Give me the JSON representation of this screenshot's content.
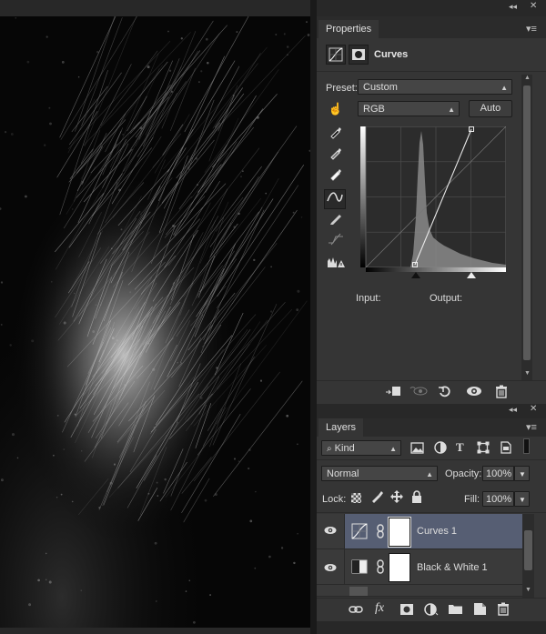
{
  "properties_panel": {
    "tab_label": "Properties",
    "panel_title": "Curves",
    "preset_label": "Preset:",
    "preset_value": "Custom",
    "channel_value": "RGB",
    "auto_button": "Auto",
    "input_label": "Input:",
    "output_label": "Output:",
    "tools": [
      "hand-adjust-icon",
      "sample-black-eyedropper-icon",
      "sample-gray-eyedropper-icon",
      "sample-white-eyedropper-icon",
      "curve-points-icon",
      "pencil-draw-icon",
      "smooth-curve-icon",
      "clipping-warning-icon"
    ],
    "curve_points": [
      [
        0.35,
        0.0
      ],
      [
        1.0,
        1.0
      ]
    ],
    "footer_icons": [
      "clip-to-layer-icon",
      "view-previous-icon",
      "reset-icon",
      "visibility-icon",
      "trash-icon"
    ]
  },
  "layers_panel": {
    "tab_label": "Layers",
    "filter_kind": "Kind",
    "blend_mode": "Normal",
    "opacity_label": "Opacity:",
    "opacity_value": "100%",
    "lock_label": "Lock:",
    "fill_label": "Fill:",
    "fill_value": "100%",
    "layers": [
      {
        "name": "Curves 1",
        "selected": true,
        "type": "curves"
      },
      {
        "name": "Black & White 1",
        "selected": false,
        "type": "bw"
      }
    ],
    "footer_icons": [
      "link-icon",
      "fx-icon",
      "mask-icon",
      "adjustment-icon",
      "group-icon",
      "new-layer-icon",
      "trash-icon"
    ]
  },
  "colors": {
    "selected_layer": "#565e73",
    "panel_bg": "#353535",
    "canvas_bg": "#050505"
  }
}
